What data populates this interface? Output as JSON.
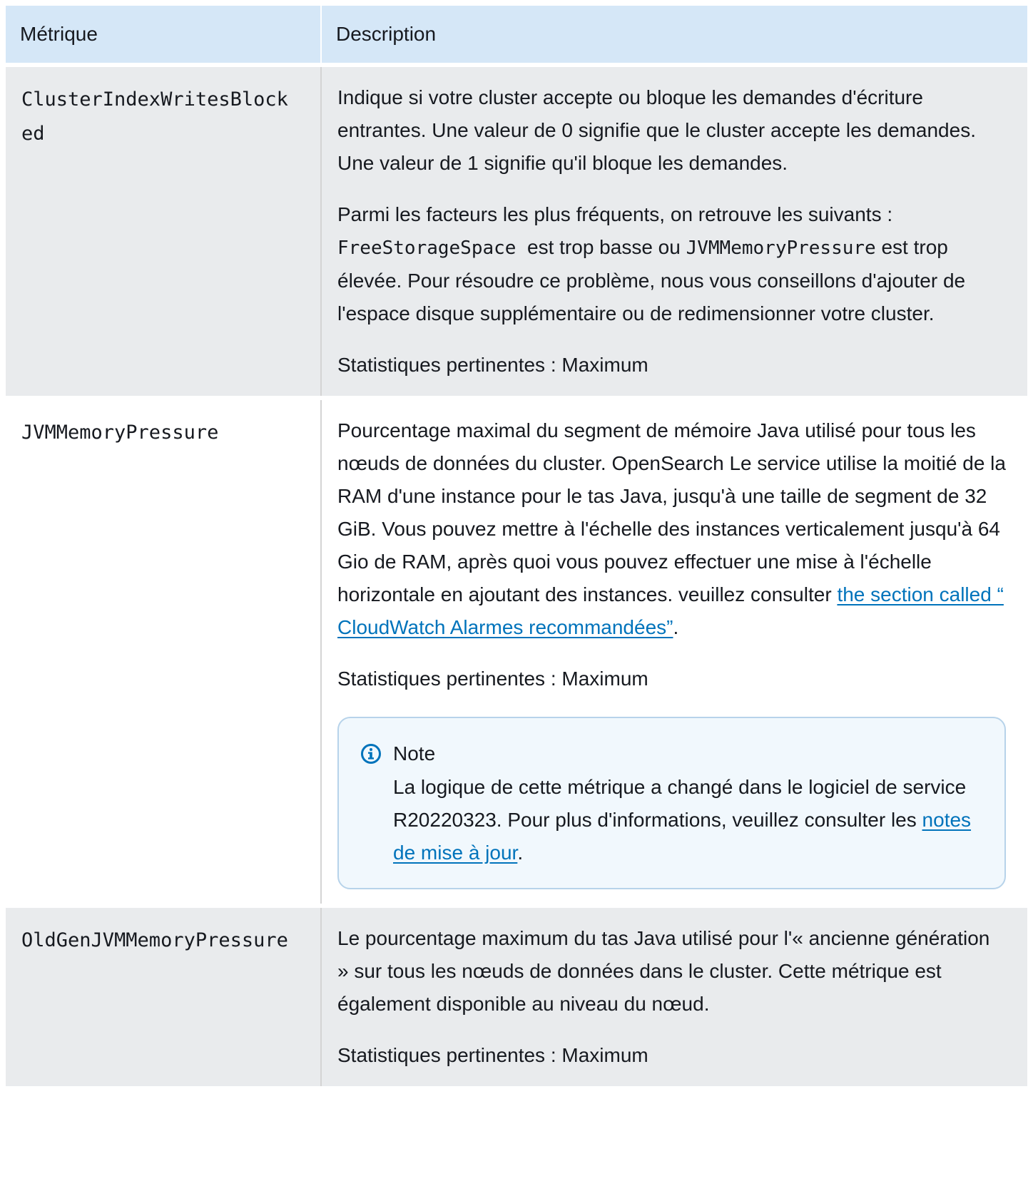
{
  "table": {
    "headers": [
      "Métrique",
      "Description"
    ],
    "rows": [
      {
        "metric": "ClusterIndexWritesBlocked",
        "p1": "Indique si votre cluster accepte ou bloque les demandes d'écriture entrantes. Une valeur de 0 signifie que le cluster accepte les demandes. Une valeur de 1 signifie qu'il bloque les demandes.",
        "p2_a": "Parmi les facteurs les plus fréquents, on retrouve les suivants : ",
        "p2_code1": "FreeStorageSpace",
        "p2_b": "  est trop basse ou ",
        "p2_code2": "JVMMemoryPressure",
        "p2_c": " est trop élevée. Pour résoudre ce problème, nous vous conseillons d'ajouter de l'espace disque supplémentaire ou de redimensionner votre cluster.",
        "stats": "Statistiques pertinentes : Maximum"
      },
      {
        "metric": "JVMMemoryPressure",
        "p1_a": "Pourcentage maximal du segment de mémoire Java utilisé pour tous les nœuds de données du cluster. OpenSearch Le service utilise la moitié de la RAM d'une instance pour le tas Java, jusqu'à une taille de segment de 32 GiB. Vous pouvez mettre à l'échelle des instances verticalement jusqu'à 64 Gio de RAM, après quoi vous pouvez effectuer une mise à l'échelle horizontale en ajoutant des instances. veuillez consulter ",
        "p1_link": "the section called “ CloudWatch Alarmes recommandées”",
        "p1_b": ".",
        "stats": "Statistiques pertinentes : Maximum",
        "note": {
          "title": "Note",
          "icon": "info-icon",
          "text_a": "La logique de cette métrique a changé dans le logiciel de service R20220323. Pour plus d'informations, veuillez consulter les ",
          "link": "notes de mise à jour",
          "text_b": "."
        }
      },
      {
        "metric": "OldGenJVMMemoryPressure",
        "p1": "Le pourcentage maximum du tas Java utilisé pour l'« ancienne génération » sur tous les nœuds de données dans le cluster. Cette métrique est également disponible au niveau du nœud.",
        "stats": "Statistiques pertinentes : Maximum"
      }
    ]
  },
  "colors": {
    "header_bg": "#d5e7f7",
    "row_alt_bg": "#e9ebed",
    "link": "#0073bb",
    "note_bg": "#f1f8fd",
    "note_border": "#b7d3ea"
  }
}
